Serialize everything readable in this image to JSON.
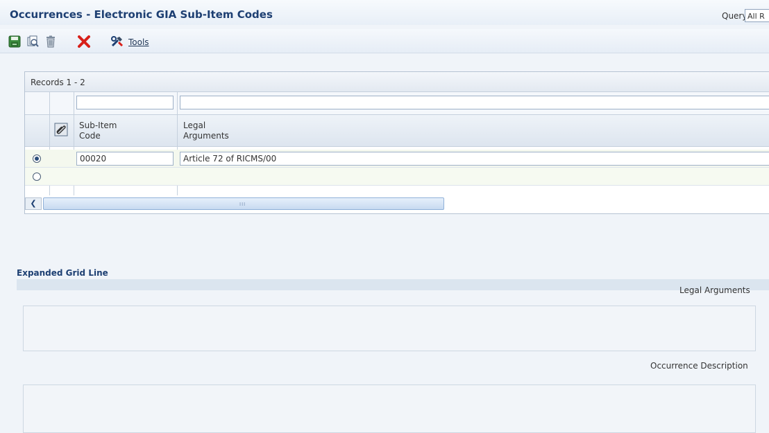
{
  "window": {
    "title": "Occurrences - Electronic GIA Sub-Item Codes",
    "query_label": "Query:",
    "query_value": "All R"
  },
  "toolbar": {
    "tools_label": "Tools"
  },
  "grid": {
    "records_label": "Records 1 - 2",
    "columns": [
      {
        "label_line1": "Sub-Item",
        "label_line2": "Code"
      },
      {
        "label_line1": "Legal",
        "label_line2": "Arguments"
      }
    ],
    "rows": [
      {
        "selected": true,
        "sub_item_code": "00020",
        "legal_arguments": "Article 72 of RICMS/00"
      },
      {
        "selected": false,
        "sub_item_code": "",
        "legal_arguments": ""
      }
    ],
    "scrollbar_grip": "III"
  },
  "expanded": {
    "section_title": "Expanded Grid Line",
    "legal_arguments_label": "Legal Arguments",
    "occurrence_description_label": "Occurrence Description"
  },
  "colors": {
    "title_blue": "#1d3f72",
    "delete_red": "#d8201a",
    "save_green": "#3a8a3c"
  }
}
